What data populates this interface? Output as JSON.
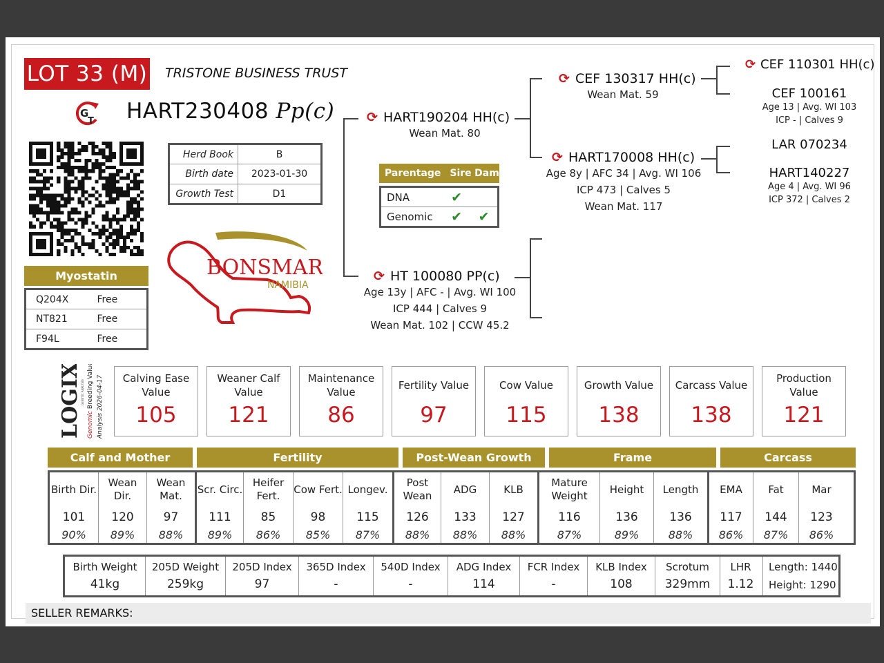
{
  "lot": "LOT 33 (M)",
  "seller": "TRISTONE BUSINESS TRUST",
  "animal": {
    "id": "HART230408",
    "poll": "Pp(c)"
  },
  "info": [
    {
      "label": "Herd Book",
      "value": "B"
    },
    {
      "label": "Birth date",
      "value": "2023-01-30"
    },
    {
      "label": "Growth Test",
      "value": "D1"
    }
  ],
  "myostatin": {
    "title": "Myostatin",
    "rows": [
      {
        "gene": "Q204X",
        "status": "Free"
      },
      {
        "gene": "NT821",
        "status": "Free"
      },
      {
        "gene": "F94L",
        "status": "Free"
      }
    ]
  },
  "brand": {
    "name": "BONSMARA",
    "region": "NAMIBIA"
  },
  "logix": {
    "name": "LOGIX",
    "tagline": "GENETIC ANALYSIS",
    "line1_a": "Genomic",
    "line1_b": "Breeding Value",
    "line2": "Analysis 2026-04-17"
  },
  "logo_text": {
    "g": "G",
    "t": "T"
  },
  "pedigree": {
    "sire": {
      "name": "HART190204 HH(c)",
      "line1": "Wean Mat. 80"
    },
    "dam": {
      "name": "HT 100080 PP(c)",
      "line1": "Age 13y | AFC - | Avg. WI 100",
      "line2": "ICP 444 | Calves 9",
      "line3": "Wean Mat. 102 | CCW 45.2"
    },
    "ss": {
      "name": "CEF 130317 HH(c)",
      "line1": "Wean Mat. 59"
    },
    "sd": {
      "name": "HART170008 HH(c)",
      "line1": "Age 8y | AFC 34 | Avg. WI 106",
      "line2": "ICP 473 | Calves 5",
      "line3": "Wean Mat. 117"
    },
    "sss": {
      "name": "CEF 110301 HH(c)"
    },
    "ssd": {
      "name": "CEF 100161",
      "line1": "Age 13 | Avg. WI 103",
      "line2": "ICP - | Calves 9"
    },
    "sds": {
      "name": "LAR 070234"
    },
    "sdd": {
      "name": "HART140227",
      "line1": "Age 4 | Avg. WI 96",
      "line2": "ICP 372 | Calves 2"
    }
  },
  "parentage": {
    "headers": [
      "Parentage",
      "Sire",
      "Dam"
    ],
    "rows": [
      {
        "label": "DNA",
        "sire": "✔",
        "dam": ""
      },
      {
        "label": "Genomic",
        "sire": "✔",
        "dam": "✔"
      }
    ]
  },
  "ebv_indexes": [
    {
      "name": "Calving Ease Value",
      "value": "105"
    },
    {
      "name": "Weaner Calf Value",
      "value": "121"
    },
    {
      "name": "Maintenance Value",
      "value": "86"
    },
    {
      "name": "Fertility Value",
      "value": "97"
    },
    {
      "name": "Cow Value",
      "value": "115"
    },
    {
      "name": "Growth Value",
      "value": "138"
    },
    {
      "name": "Carcass Value",
      "value": "138"
    },
    {
      "name": "Production Value",
      "value": "121"
    }
  ],
  "groups": [
    "Calf and Mother",
    "Fertility",
    "Post-Wean Growth",
    "Frame",
    "Carcass"
  ],
  "traits": [
    {
      "name": "Birth Dir.",
      "score": "101",
      "acc": "90%"
    },
    {
      "name": "Wean Dir.",
      "score": "120",
      "acc": "89%"
    },
    {
      "name": "Wean Mat.",
      "score": "97",
      "acc": "88%"
    },
    {
      "name": "Scr. Circ.",
      "score": "111",
      "acc": "89%"
    },
    {
      "name": "Heifer Fert.",
      "score": "85",
      "acc": "86%"
    },
    {
      "name": "Cow Fert.",
      "score": "98",
      "acc": "85%"
    },
    {
      "name": "Longev.",
      "score": "115",
      "acc": "87%"
    },
    {
      "name": "Post Wean",
      "score": "126",
      "acc": "88%"
    },
    {
      "name": "ADG",
      "score": "133",
      "acc": "88%"
    },
    {
      "name": "KLB",
      "score": "127",
      "acc": "88%"
    },
    {
      "name": "Mature Weight",
      "score": "116",
      "acc": "87%"
    },
    {
      "name": "Height",
      "score": "136",
      "acc": "89%"
    },
    {
      "name": "Length",
      "score": "136",
      "acc": "88%"
    },
    {
      "name": "EMA",
      "score": "117",
      "acc": "86%"
    },
    {
      "name": "Fat",
      "score": "144",
      "acc": "87%"
    },
    {
      "name": "Mar",
      "score": "123",
      "acc": "86%"
    }
  ],
  "performance": [
    {
      "label": "Birth Weight",
      "value": "41kg"
    },
    {
      "label": "205D Weight",
      "value": "259kg"
    },
    {
      "label": "205D Index",
      "value": "97"
    },
    {
      "label": "365D Index",
      "value": "-"
    },
    {
      "label": "540D Index",
      "value": "-"
    },
    {
      "label": "ADG Index",
      "value": "114"
    },
    {
      "label": "FCR Index",
      "value": "-"
    },
    {
      "label": "KLB Index",
      "value": "108"
    },
    {
      "label": "Scrotum",
      "value": "329mm"
    },
    {
      "label": "LHR",
      "value": "1.12"
    }
  ],
  "size": {
    "length_label": "Length:",
    "length": "1440",
    "height_label": "Height:",
    "height": "1290"
  },
  "remarks_label": "SELLER REMARKS:",
  "colors": {
    "red": "#c8191f",
    "gold": "#a9922b",
    "check": "#2e8b2e"
  }
}
